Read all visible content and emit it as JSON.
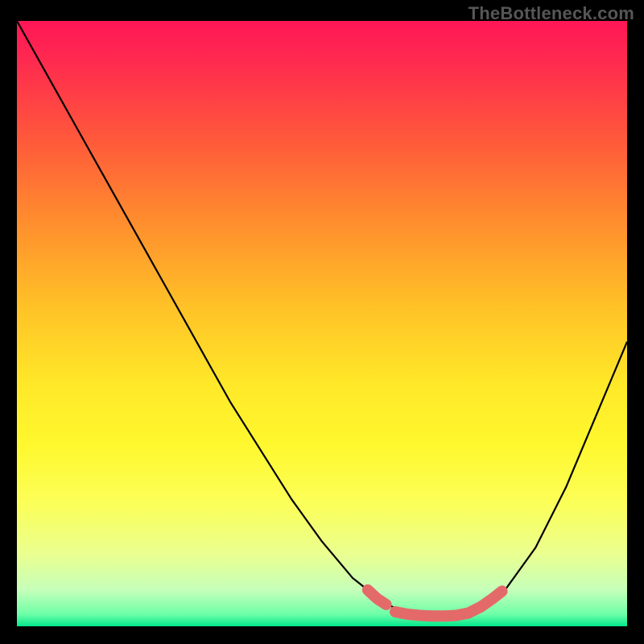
{
  "attribution": "TheBottleneck.com",
  "chart_data": {
    "type": "line",
    "title": "",
    "xlabel": "",
    "ylabel": "",
    "xlim": [
      0,
      100
    ],
    "ylim": [
      0,
      100
    ],
    "grid": false,
    "series": [
      {
        "name": "bottleneck-curve",
        "color": "#000000",
        "x": [
          0,
          5,
          10,
          15,
          20,
          25,
          30,
          35,
          40,
          45,
          50,
          55,
          57.5,
          60,
          62,
          64,
          66,
          68,
          70,
          72,
          74,
          76,
          78,
          80,
          85,
          90,
          95,
          100
        ],
        "y": [
          100,
          91,
          82,
          73,
          64,
          55,
          46,
          37,
          29,
          21,
          14,
          8,
          6,
          4,
          3,
          2.2,
          1.8,
          1.6,
          1.6,
          1.8,
          2.2,
          3,
          4.2,
          6,
          13,
          23,
          35,
          47
        ]
      },
      {
        "name": "optimal-segment-left",
        "color": "#e46a6a",
        "x": [
          57.5,
          59,
          60.5
        ],
        "y": [
          6,
          4.6,
          3.6
        ]
      },
      {
        "name": "optimal-segment-bottom",
        "color": "#e46a6a",
        "x": [
          62,
          64,
          66,
          68,
          70,
          72,
          74
        ],
        "y": [
          2.4,
          2,
          1.8,
          1.7,
          1.7,
          1.8,
          2.2
        ]
      },
      {
        "name": "optimal-segment-right",
        "color": "#e46a6a",
        "x": [
          74,
          76,
          78,
          79.5
        ],
        "y": [
          2.2,
          3.2,
          4.6,
          5.8
        ]
      }
    ],
    "annotations": []
  }
}
